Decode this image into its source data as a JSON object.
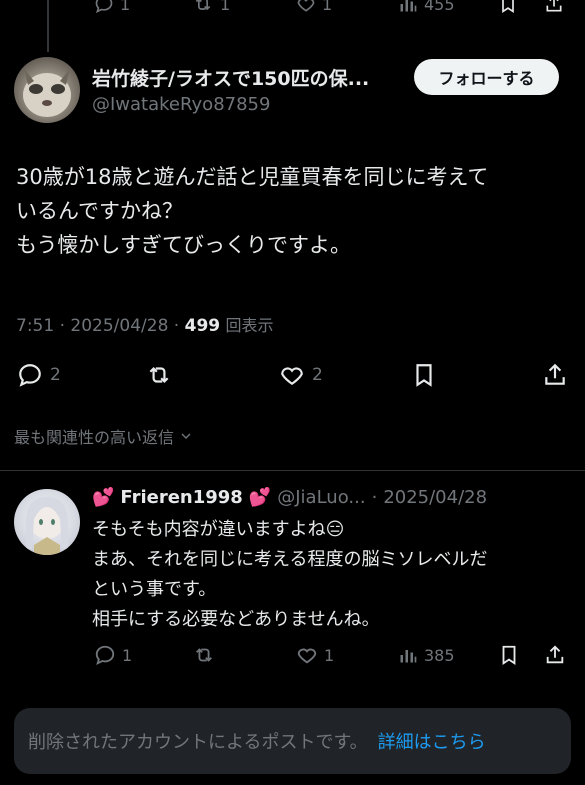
{
  "top_actions": {
    "reply_count": "1",
    "repost_count": "1",
    "like_count": "1",
    "view_count": "455"
  },
  "post": {
    "author_name": "岩竹綾子/ラオスで150匹の保...",
    "author_handle": "@IwatakeRyo87859",
    "follow_label": "フォローする",
    "body_lines": [
      "30歳が18歳と遊んだ話と児童買春を同じに考えて",
      "いるんですかね？",
      "もう懐かしすぎてびっくりですよ。"
    ],
    "time": "7:51",
    "date": "2025/04/28",
    "views": "499",
    "views_label": "回表示",
    "reply_count": "2",
    "like_count": "2"
  },
  "sort_label": "最も関連性の高い返信",
  "reply": {
    "name": "Frieren1998",
    "name_emoji": "💕",
    "handle": "@JiaLuo...",
    "date": "2025/04/28",
    "body_lines": [
      "そもそも内容が違いますよね😑",
      "まあ、それを同じに考える程度の脳ミソレベルだ",
      "という事です。",
      "相手にする必要などありませんね。"
    ],
    "reply_count": "1",
    "like_count": "1",
    "view_count": "385"
  },
  "notice": {
    "text": "削除されたアカウントによるポストです。",
    "link": "詳細はこちら"
  },
  "colors": {
    "background": "#000000",
    "text": "#e7e9ea",
    "muted": "#71767b",
    "link": "#1d9bf0",
    "follow_bg": "#eff3f4"
  }
}
